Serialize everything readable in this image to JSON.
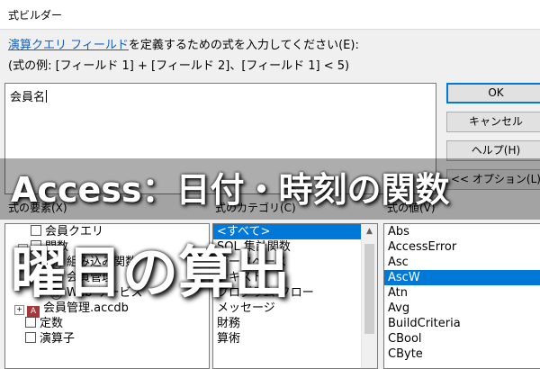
{
  "window": {
    "title": "式ビルダー"
  },
  "instructions": {
    "link": "演算クエリ フィールド",
    "line1_rest": "を定義するための式を入力してください(E):",
    "line2": "(式の例: [フィールド 1] + [フィールド 2]、[フィールド 1] < 5)"
  },
  "expression": {
    "value": "会員名"
  },
  "buttons": {
    "ok": "OK",
    "cancel": "キャンセル",
    "help": "ヘルプ(H)",
    "options": "<< オプション(L)"
  },
  "sections": {
    "elements_label": "式の要素(X)",
    "categories_label": "式のカテゴリ(C)",
    "values_label": "式の値(V)"
  },
  "elements": [
    {
      "label": "会員クエリ",
      "icon": "query-icon"
    },
    {
      "label": "関数",
      "icon": "folder-icon"
    },
    {
      "label": "組み込み関数",
      "icon": "fx-icon"
    },
    {
      "label": "会員管理",
      "icon": "fx-icon"
    },
    {
      "label": "Web サービス",
      "icon": "fx-icon"
    },
    {
      "label": "会員管理.accdb",
      "icon": "database-icon"
    },
    {
      "label": "定数",
      "icon": "folder-icon"
    },
    {
      "label": "演算子",
      "icon": "folder-icon"
    }
  ],
  "categories": [
    "<すべて>",
    "SQL 集計関数",
    "データベース",
    "テキスト",
    "プログラム フロー",
    "メッセージ",
    "財務",
    "算術"
  ],
  "categories_selected": 0,
  "values": [
    "Abs",
    "AccessError",
    "Asc",
    "AscW",
    "Atn",
    "Avg",
    "BuildCriteria",
    "CBool",
    "CByte"
  ],
  "values_selected": 3,
  "overlay": {
    "line1": "Access：日付・時刻の関数",
    "line2": "曜日の算出"
  },
  "colors": {
    "accent": "#0078d7",
    "link": "#1a5fb4"
  }
}
